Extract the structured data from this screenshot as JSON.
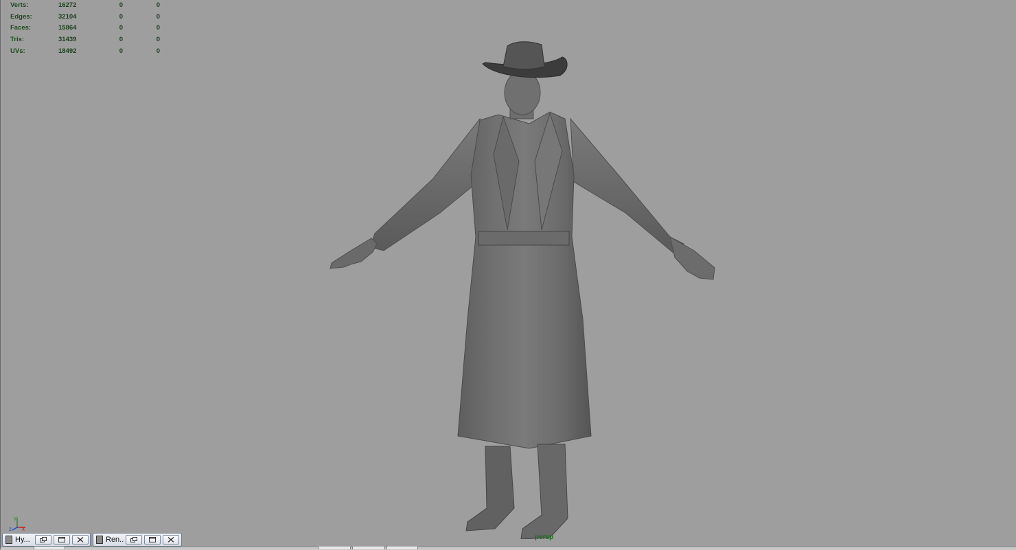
{
  "hud": {
    "rows": [
      {
        "label": "Verts:",
        "v1": "16272",
        "v2": "0",
        "v3": "0"
      },
      {
        "label": "Edges:",
        "v1": "32104",
        "v2": "0",
        "v3": "0"
      },
      {
        "label": "Faces:",
        "v1": "15864",
        "v2": "0",
        "v3": "0"
      },
      {
        "label": "Tris:",
        "v1": "31439",
        "v2": "0",
        "v3": "0"
      },
      {
        "label": "UVs:",
        "v1": "18492",
        "v2": "0",
        "v3": "0"
      }
    ]
  },
  "viewport": {
    "camera_name": "persp",
    "axis": {
      "y": "y",
      "z": "z",
      "x": "x"
    },
    "colors": {
      "background": "#9e9e9e",
      "hud_text": "#1f4a1f",
      "camera_label": "#1f6a1f"
    }
  },
  "minimized_windows": [
    {
      "title": "Hy...",
      "icon": "app-window-icon"
    },
    {
      "title": "Ren...",
      "icon": "app-window-icon"
    }
  ]
}
